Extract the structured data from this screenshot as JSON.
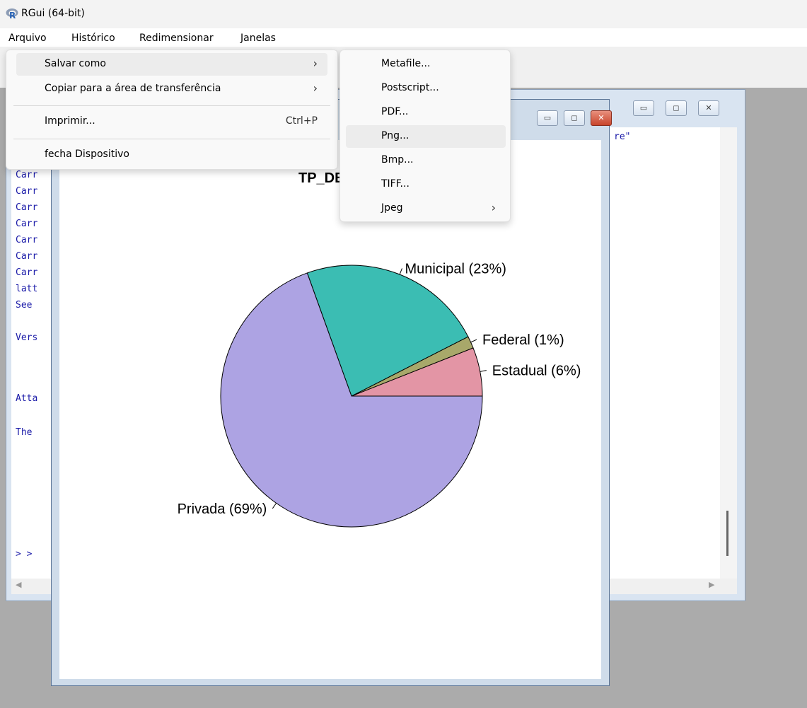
{
  "window": {
    "title": "RGui (64-bit)"
  },
  "menubar": {
    "items": [
      "Arquivo",
      "Histórico",
      "Redimensionar",
      "Janelas"
    ]
  },
  "file_menu": {
    "items": [
      {
        "label": "Salvar como",
        "shortcut": "",
        "submenu": true
      },
      {
        "label": "Copiar para a área de transferência",
        "shortcut": "",
        "submenu": true
      },
      {
        "label": "Imprimir...",
        "shortcut": "Ctrl+P",
        "submenu": false
      },
      {
        "label": "fecha Dispositivo",
        "shortcut": "",
        "submenu": false
      }
    ]
  },
  "save_submenu": {
    "items": [
      "Metafile...",
      "Postscript...",
      "PDF...",
      "Png...",
      "Bmp...",
      "TIFF...",
      "Jpeg"
    ],
    "hovered": "Png..."
  },
  "console": {
    "lines": [
      "Carr",
      "Carr",
      "Carr",
      "Carr",
      "Carr",
      "Carr",
      "Carr",
      "latt",
      "See",
      "Vers",
      "Atta",
      "The",
      "> >"
    ],
    "partial_right": "re\""
  },
  "chart_data": {
    "type": "pie",
    "title": "TP_DEP",
    "slices": [
      {
        "label": "Estadual (6%)",
        "value": 6,
        "color": "#e395a5"
      },
      {
        "label": "Federal (1%)",
        "value": 1.5,
        "color": "#a8a86a"
      },
      {
        "label": "Municipal (23%)",
        "value": 23,
        "color": "#3bbdb3"
      },
      {
        "label": "Privada (69%)",
        "value": 69.5,
        "color": "#ada3e3"
      }
    ]
  },
  "icons": [
    "r-logo-icon",
    "minimize-icon",
    "maximize-icon",
    "close-icon",
    "chevron-right-icon"
  ],
  "colors": {
    "console_text": "#1a1aa8",
    "menu_hover": "#ececec",
    "mdi_background": "#ababab"
  }
}
